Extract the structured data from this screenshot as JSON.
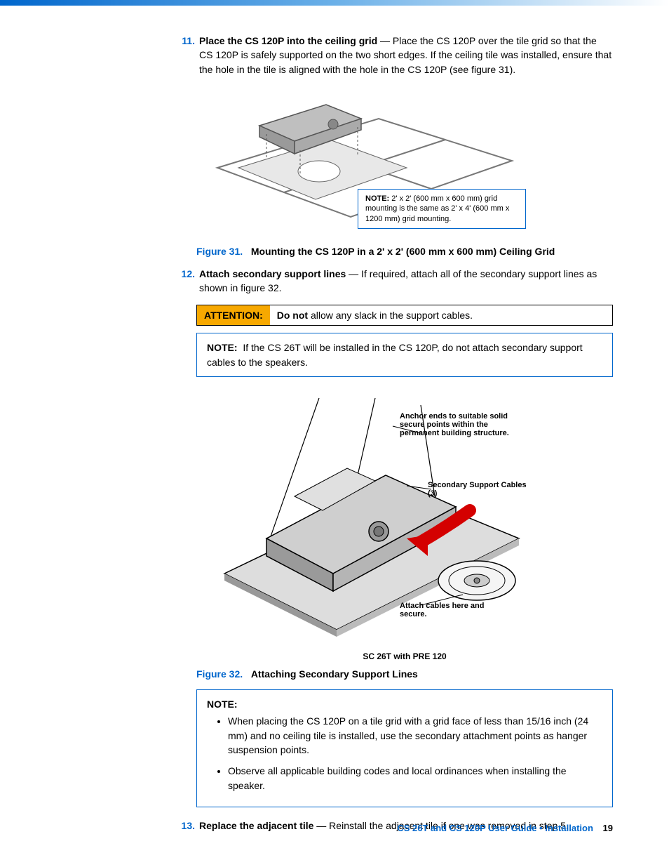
{
  "steps": {
    "s11": {
      "num": "11.",
      "title": "Place the CS 120P into the ceiling grid",
      "body": " — Place the CS 120P over the tile grid so that the CS 120P is safely supported on the two short edges. If the ceiling tile was installed, ensure that the hole in the tile is aligned with the hole in the CS 120P (see figure 31)."
    },
    "s12": {
      "num": "12.",
      "title": "Attach secondary support lines",
      "body": " — If required, attach all of the secondary support lines as shown in figure 32."
    },
    "s13": {
      "num": "13.",
      "title": "Replace the adjacent tile",
      "body": " — Reinstall the adjacent tile if one was removed in step 5."
    }
  },
  "fig31": {
    "note_label": "NOTE:",
    "note_text": "2' x 2' (600 mm x 600 mm) grid mounting is the same as 2' x 4' (600 mm x 1200 mm) grid mounting.",
    "caption_prefix": "Figure 31.",
    "caption_text": "Mounting the CS 120P in a 2' x 2' (600 mm x 600 mm) Ceiling Grid"
  },
  "attention": {
    "label": "ATTENTION:",
    "bold": "Do not",
    "rest": " allow any slack in the support cables."
  },
  "note_cs26t": {
    "label": "NOTE:",
    "text": "If the CS 26T will be installed in the CS 120P, do not attach secondary support cables to the speakers."
  },
  "fig32": {
    "anchor_text": "Anchor ends to suitable solid secure points within the permanent building structure.",
    "secondary_text": "Secondary Support Cables (3)",
    "attach_text": "Attach cables here and secure.",
    "sublabel": "SC 26T with PRE 120",
    "caption_prefix": "Figure 32.",
    "caption_text": "Attaching Secondary Support Lines"
  },
  "final_note": {
    "label": "NOTE:",
    "bullet1": "When placing the CS 120P on a tile grid with a grid face of less than 15/16 inch (24 mm) and no ceiling tile is installed, use the secondary attachment points as hanger suspension points.",
    "bullet2": "Observe all applicable building codes and local ordinances when installing the speaker."
  },
  "footer": {
    "text": "CS 26T and CS 120P User Guide • Installation",
    "page": "19"
  }
}
